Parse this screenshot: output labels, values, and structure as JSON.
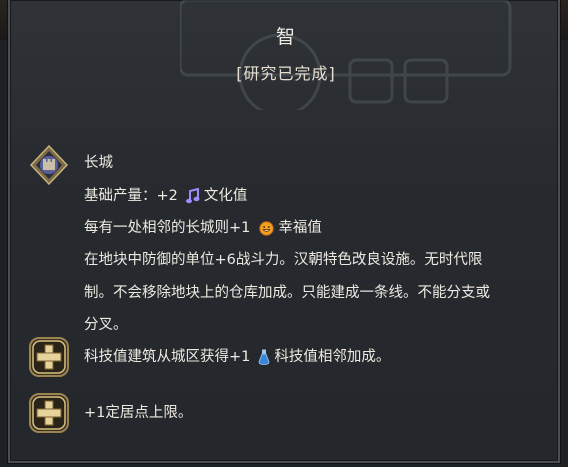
{
  "tooltip": {
    "title": "智",
    "status": "[研究已完成]"
  },
  "improvement": {
    "name": "长城",
    "base_yield_label": "基础产量：",
    "base_yield_amount": "+2",
    "base_yield_type": "文化值",
    "adjacency_text": "每有一处相邻的长城则+1",
    "adjacency_type": "幸福值",
    "description_line1": "在地块中防御的单位+6战斗力。汉朝特色改良设施。无时代限",
    "description_line2": "制。不会移除地块上的仓库加成。只能建成一条线。不能分支或",
    "description_line3": "分叉。"
  },
  "bonuses": [
    {
      "text_before": "科技值建筑从城区获得+1",
      "text_after": "科技值相邻加成。"
    },
    {
      "text_before": "+1定居点上限。",
      "text_after": ""
    }
  ],
  "icons": {
    "improvement": "great-wall-icon",
    "culture": "music-note-icon",
    "amenity": "smiley-face-icon",
    "science": "flask-icon",
    "bonus": "plus-icon"
  },
  "colors": {
    "panel_bg": "#2a2e32",
    "text": "#ece9e1",
    "culture": "#9b8cff",
    "amenity": "#f0a020",
    "science": "#5aa0e8",
    "gold_frame": "#b99a55"
  }
}
